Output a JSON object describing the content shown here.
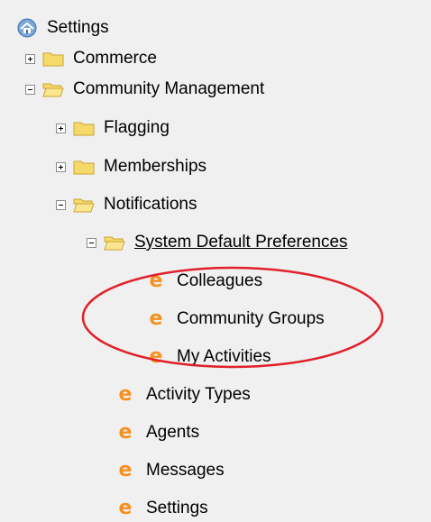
{
  "tree": {
    "root": {
      "label": "Settings",
      "icon": "home-settings-icon"
    },
    "items": [
      {
        "label": "Commerce",
        "state": "collapsed",
        "icon": "folder-closed-icon"
      },
      {
        "label": "Community Management",
        "state": "expanded",
        "icon": "folder-open-icon"
      },
      {
        "label": "Flagging",
        "state": "collapsed",
        "icon": "folder-closed-icon"
      },
      {
        "label": "Memberships",
        "state": "collapsed",
        "icon": "folder-closed-icon"
      },
      {
        "label": "Notifications",
        "state": "expanded",
        "icon": "folder-open-icon"
      },
      {
        "label": "System Default Preferences",
        "state": "expanded",
        "icon": "folder-open-icon"
      },
      {
        "label": "Colleagues",
        "icon": "e-icon"
      },
      {
        "label": "Community Groups",
        "icon": "e-icon"
      },
      {
        "label": "My Activities",
        "icon": "e-icon"
      },
      {
        "label": "Activity Types",
        "icon": "e-icon"
      },
      {
        "label": "Agents",
        "icon": "e-icon"
      },
      {
        "label": "Messages",
        "icon": "e-icon"
      },
      {
        "label": "Settings",
        "icon": "e-icon"
      }
    ],
    "leaf_glyph": "e"
  },
  "colors": {
    "background": "#f0f0f0",
    "folder_fill": "#f6d96b",
    "leaf_icon": "#f5901e",
    "annotation_ellipse": "#e0202a"
  }
}
